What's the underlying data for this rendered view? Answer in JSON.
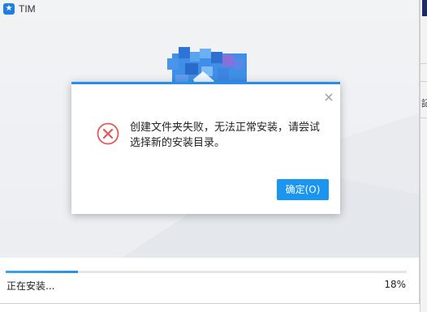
{
  "window": {
    "title": "TIM",
    "app_icon_glyph": "★"
  },
  "installer": {
    "status": "正在安装...",
    "percent_text": "18%",
    "progress": 0.18
  },
  "dialog": {
    "message": "创建文件夹失败，无法正常安装，请尝试选择新的安装目录。",
    "ok_label": "确定(O)",
    "close_glyph": "×",
    "icon": "error-icon"
  },
  "background_window": {
    "partial_glyph": "記"
  },
  "colors": {
    "accent": "#2a8ee6",
    "button": "#1a95f0",
    "error": "#e05a57"
  }
}
